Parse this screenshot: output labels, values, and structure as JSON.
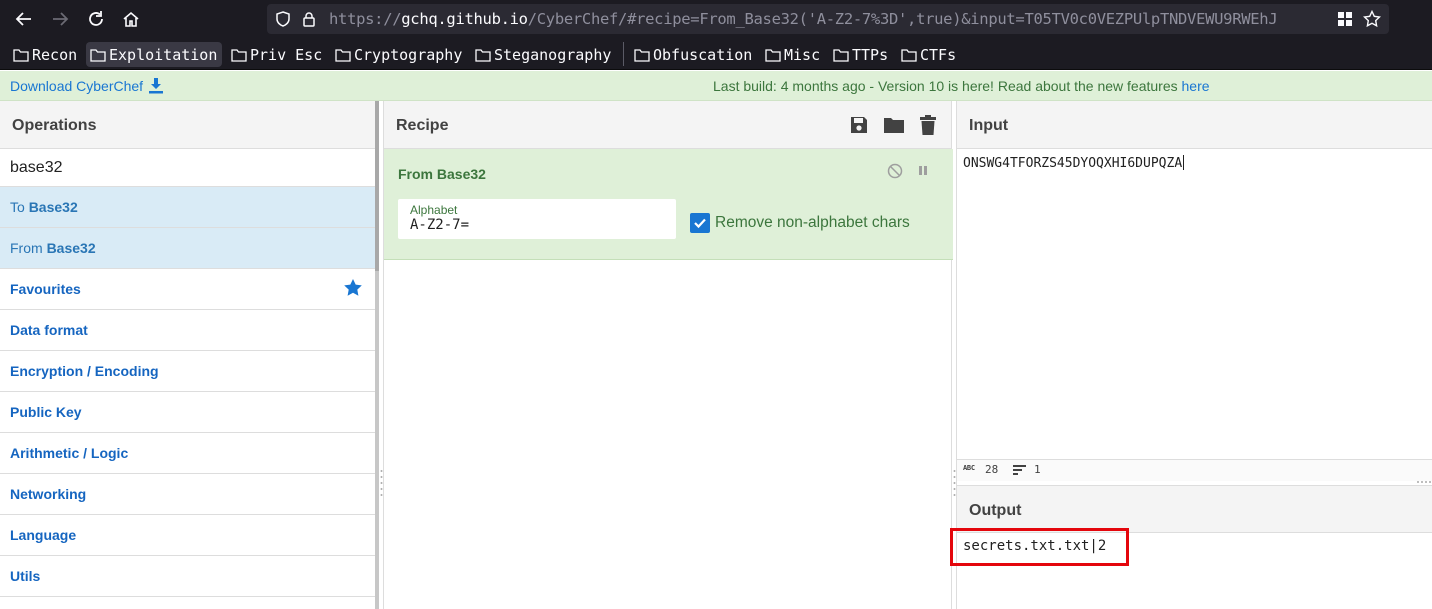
{
  "browser": {
    "url_prefix": "https://",
    "url_host": "gchq.github.io",
    "url_path": "/CyberChef/#recipe=From_Base32('A-Z2-7%3D',true)&input=T05TV0c0VEZPUlpTNDVEWU9RWEhJ"
  },
  "bookmarks": [
    {
      "label": "Recon"
    },
    {
      "label": "Exploitation"
    },
    {
      "label": "Priv Esc"
    },
    {
      "label": "Cryptography"
    },
    {
      "label": "Steganography"
    },
    {
      "label": "Obfuscation"
    },
    {
      "label": "Misc"
    },
    {
      "label": "TTPs"
    },
    {
      "label": "CTFs"
    }
  ],
  "banner": {
    "download_label": "Download CyberChef",
    "notice": "Last build: 4 months ago - Version 10 is here! Read about the new features ",
    "notice_link": "here"
  },
  "operations": {
    "title": "Operations",
    "search_value": "base32",
    "results": [
      {
        "prefix": "To ",
        "match": "Base32"
      },
      {
        "prefix": "From ",
        "match": "Base32"
      }
    ],
    "categories": [
      "Favourites",
      "Data format",
      "Encryption / Encoding",
      "Public Key",
      "Arithmetic / Logic",
      "Networking",
      "Language",
      "Utils"
    ]
  },
  "recipe": {
    "title": "Recipe",
    "operation": {
      "name": "From Base32",
      "alphabet_label": "Alphabet",
      "alphabet_value": "A-Z2-7=",
      "remove_label": "Remove non-alphabet chars",
      "remove_checked": true
    }
  },
  "io": {
    "input_title": "Input",
    "input_value": "ONSWG4TFORZS45DYOQXHI6DUPQZA",
    "status_length": "28",
    "status_lines": "1",
    "output_title": "Output",
    "output_value": "secrets.txt.txt|2"
  },
  "colors": {
    "banner_bg": "#dff0d8",
    "accent_blue": "#1976d2",
    "highlight_red": "#e4060c"
  }
}
